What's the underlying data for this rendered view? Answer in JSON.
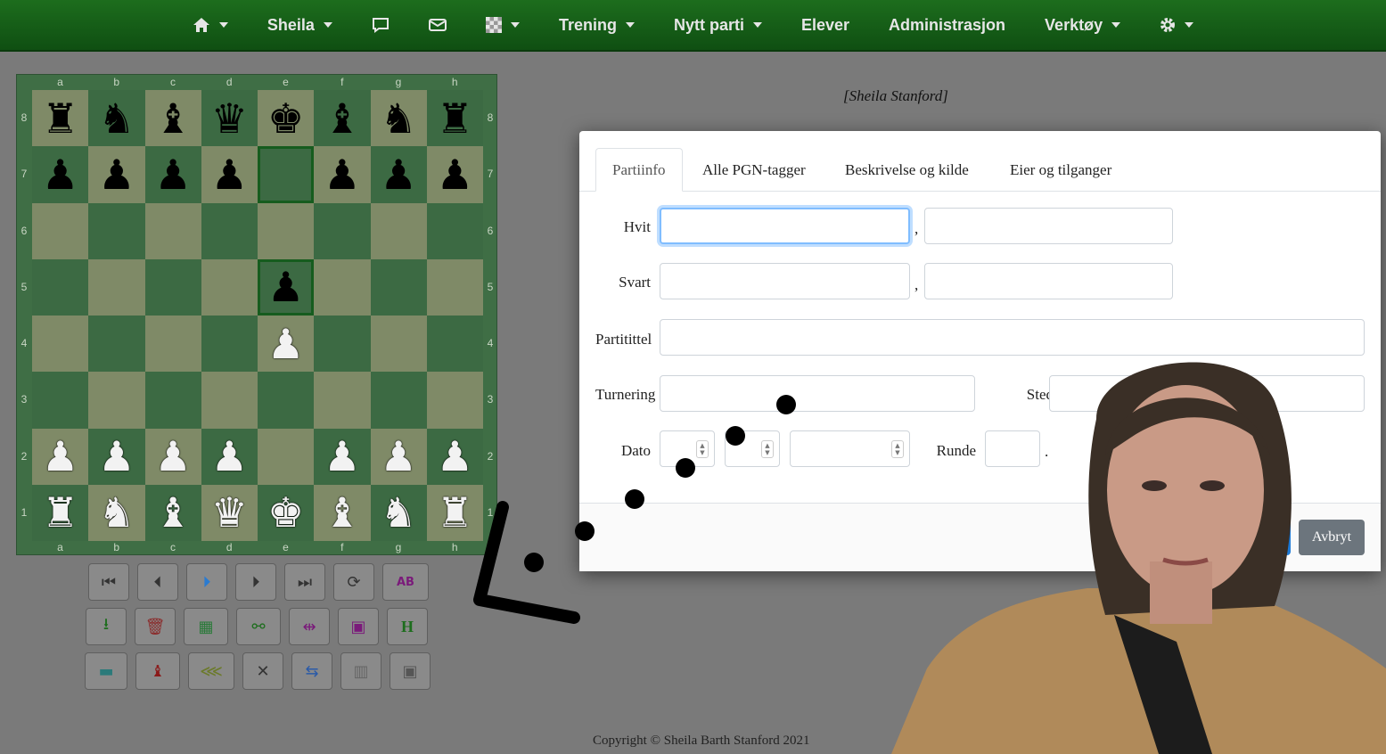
{
  "nav": {
    "items": [
      {
        "label": "",
        "icon": "home-icon",
        "caret": true
      },
      {
        "label": "Sheila",
        "caret": true
      },
      {
        "label": "",
        "icon": "chat-icon",
        "caret": false
      },
      {
        "label": "",
        "icon": "mail-icon",
        "caret": false
      },
      {
        "label": "",
        "icon": "board-icon",
        "caret": true
      },
      {
        "label": "Trening",
        "caret": true
      },
      {
        "label": "Nytt parti",
        "caret": true
      },
      {
        "label": "Elever",
        "caret": false
      },
      {
        "label": "Administrasjon",
        "caret": false
      },
      {
        "label": "Verktøy",
        "caret": true
      },
      {
        "label": "",
        "icon": "gear-icon",
        "caret": true
      }
    ]
  },
  "board": {
    "files": [
      "a",
      "b",
      "c",
      "d",
      "e",
      "f",
      "g",
      "h"
    ],
    "ranks": [
      "8",
      "7",
      "6",
      "5",
      "4",
      "3",
      "2",
      "1"
    ],
    "position": [
      [
        "r",
        "n",
        "b",
        "q",
        "k",
        "b",
        "n",
        "r"
      ],
      [
        "p",
        "p",
        "p",
        "p",
        "",
        "p",
        "p",
        "p"
      ],
      [
        "",
        "",
        "",
        "",
        "",
        "",
        "",
        ""
      ],
      [
        "",
        "",
        "",
        "",
        "p",
        "",
        "",
        ""
      ],
      [
        "",
        "",
        "",
        "",
        "P",
        "",
        "",
        ""
      ],
      [
        "",
        "",
        "",
        "",
        "",
        "",
        "",
        ""
      ],
      [
        "P",
        "P",
        "P",
        "P",
        "",
        "P",
        "P",
        "P"
      ],
      [
        "R",
        "N",
        "B",
        "Q",
        "K",
        "B",
        "N",
        "R"
      ]
    ],
    "highlighted": [
      "e7",
      "e5"
    ]
  },
  "game_header": "[Sheila Stanford]",
  "modal": {
    "tabs": [
      "Partiinfo",
      "Alle PGN-tagger",
      "Beskrivelse og kilde",
      "Eier og tilganger"
    ],
    "active_tab": "Partiinfo",
    "labels": {
      "white": "Hvit",
      "black": "Svart",
      "title": "Partitittel",
      "tournament": "Turnering",
      "place": "Sted",
      "date": "Dato",
      "round": "Runde"
    },
    "values": {
      "white_last": "",
      "white_first": "",
      "black_last": "",
      "black_first": "",
      "title": "",
      "tournament": "",
      "place": "",
      "date_day": "",
      "date_month": "",
      "date_year": "",
      "round": ""
    },
    "separator_comma": ",",
    "separator_dot": ".",
    "cancel_label": "Avbryt"
  },
  "footer": {
    "copyright": "Copyright © Sheila Barth Stanford 2021"
  },
  "colors": {
    "nav": "#1d6d1d",
    "board_light": "#7f8a67",
    "board_dark": "#3c6a43",
    "cancel_button": "#6c757d"
  }
}
